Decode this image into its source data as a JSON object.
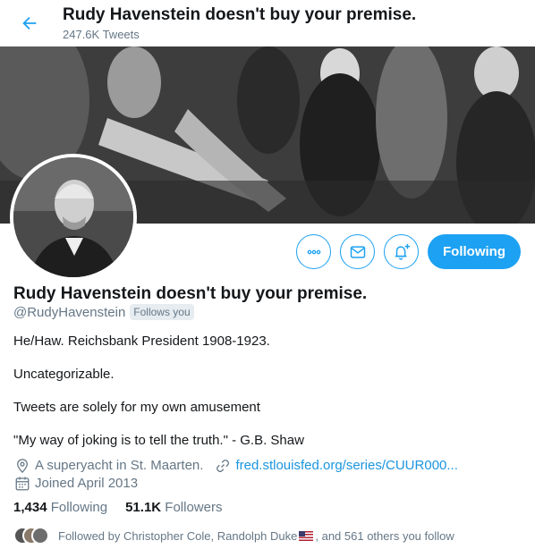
{
  "header": {
    "title": "Rudy Havenstein doesn't buy your premise.",
    "tweet_count": "247.6K Tweets"
  },
  "profile": {
    "name": "Rudy Havenstein doesn't buy your premise.",
    "handle": "@RudyHavenstein",
    "follows_you": "Follows you",
    "follow_button": "Following"
  },
  "bio": {
    "lines": [
      "He/Haw. Reichsbank President 1908-1923.",
      "Uncategorizable.",
      "Tweets are solely for my own amusement",
      "\"My way of joking is to tell the truth.\" - G.B. Shaw"
    ]
  },
  "meta": {
    "location": "A superyacht in St. Maarten.",
    "website": "fred.stlouisfed.org/series/CUUR000...",
    "joined": "Joined April 2013"
  },
  "stats": {
    "following_count": "1,434",
    "following_label": "Following",
    "followers_count": "51.1K",
    "followers_label": "Followers"
  },
  "followed_by": {
    "prefix": "Followed by Christopher Cole, Randolph Duke",
    "suffix": ", and 561 others you follow"
  },
  "icons": {
    "back": "arrow-left-icon",
    "more": "ellipsis-icon",
    "message": "envelope-icon",
    "notifications": "bell-plus-icon",
    "location": "location-pin-icon",
    "link": "link-icon",
    "calendar": "calendar-icon"
  },
  "colors": {
    "accent": "#1da1f2",
    "link": "#1b95e0",
    "secondary_text": "#657786"
  }
}
